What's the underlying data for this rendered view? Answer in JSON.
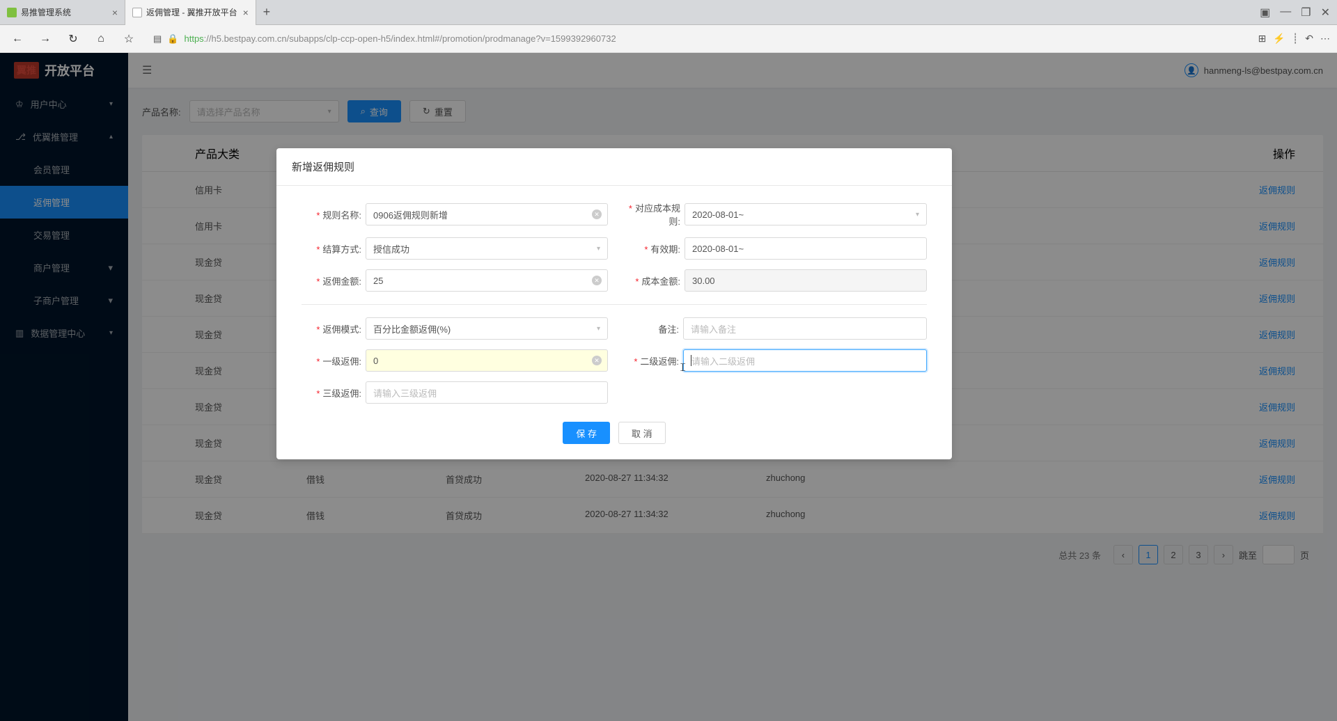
{
  "browser": {
    "tabs": [
      {
        "title": "易推管理系统"
      },
      {
        "title": "返佣管理 - 翼推开放平台"
      }
    ],
    "url_proto": "https",
    "url_host": "://h5.bestpay.com.cn/subapps/clp-ccp-open-h5/index.html#/promotion/prodmanage?v=1599392960732"
  },
  "app": {
    "logo_red": "翼推",
    "logo_text": "开放平台",
    "user": "hanmeng-ls@bestpay.com.cn",
    "menu": {
      "user_center": "用户中心",
      "yyt_manage": "优翼推管理",
      "member_manage": "会员管理",
      "commission_manage": "返佣管理",
      "trade_manage": "交易管理",
      "merchant_manage": "商户管理",
      "sub_merchant_manage": "子商户管理",
      "data_center": "数据管理中心"
    }
  },
  "filter": {
    "label": "产品名称:",
    "placeholder": "请选择产品名称",
    "search": "查询",
    "reset": "重置"
  },
  "table": {
    "header": {
      "category": "产品大类",
      "action": "操作"
    },
    "action_link": "返佣规则",
    "rows": [
      {
        "category": "信用卡",
        "name": "",
        "method": "",
        "time": "",
        "creator": ""
      },
      {
        "category": "信用卡",
        "name": "",
        "method": "",
        "time": "",
        "creator": ""
      },
      {
        "category": "现金贷",
        "name": "",
        "method": "",
        "time": "",
        "creator": ""
      },
      {
        "category": "现金贷",
        "name": "",
        "method": "",
        "time": "",
        "creator": ""
      },
      {
        "category": "现金贷",
        "name": "",
        "method": "",
        "time": "",
        "creator": ""
      },
      {
        "category": "现金贷",
        "name": "",
        "method": "",
        "time": "",
        "creator": ""
      },
      {
        "category": "现金贷",
        "name": "",
        "method": "",
        "time": "",
        "creator": ""
      },
      {
        "category": "现金贷",
        "name": "",
        "method": "",
        "time": "",
        "creator": ""
      },
      {
        "category": "现金贷",
        "name": "借钱",
        "method": "首贷成功",
        "time": "2020-08-27 11:34:32",
        "creator": "zhuchong"
      },
      {
        "category": "现金贷",
        "name": "借钱",
        "method": "首贷成功",
        "time": "2020-08-27 11:34:32",
        "creator": "zhuchong"
      }
    ]
  },
  "pagination": {
    "total": "总共 23 条",
    "pages": [
      "1",
      "2",
      "3"
    ],
    "jump_label": "跳至",
    "page_suffix": "页"
  },
  "modal": {
    "title": "新增返佣规则",
    "labels": {
      "rule_name": "规则名称:",
      "cost_rule": "对应成本规则:",
      "settle_method": "结算方式:",
      "valid_period": "有效期:",
      "commission_amount": "返佣金额:",
      "cost_amount": "成本金额:",
      "commission_mode": "返佣模式:",
      "remark": "备注:",
      "level1": "一级返佣:",
      "level2": "二级返佣:",
      "level3": "三级返佣:"
    },
    "values": {
      "rule_name": "0906返佣规则新增",
      "cost_rule": "2020-08-01~",
      "settle_method": "授信成功",
      "valid_period": "2020-08-01~",
      "commission_amount": "25",
      "cost_amount": "30.00",
      "commission_mode": "百分比金额返佣(%)",
      "level1": "0"
    },
    "placeholders": {
      "remark": "请输入备注",
      "level2": "请输入二级返佣",
      "level3": "请输入三级返佣"
    },
    "buttons": {
      "save": "保 存",
      "cancel": "取 消"
    }
  }
}
